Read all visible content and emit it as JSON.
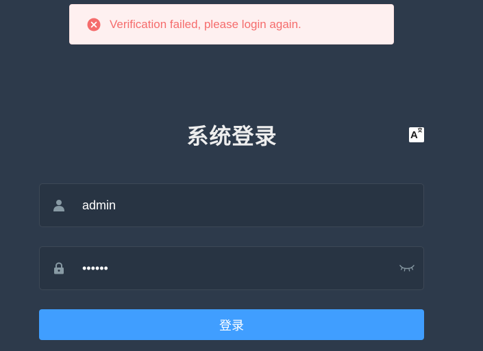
{
  "message": {
    "type": "error",
    "icon": "circle-close-icon",
    "text": "Verification failed, please login again.",
    "color": "#f56c6c",
    "background": "#fef0f0"
  },
  "login": {
    "title": "系统登录",
    "language_icon": "translate-icon",
    "username": {
      "icon": "user-icon",
      "value": "admin",
      "placeholder": ""
    },
    "password": {
      "icon": "lock-icon",
      "value": "••••••",
      "placeholder": "",
      "toggle_icon": "eye-closed-icon"
    },
    "submit_label": "登录"
  },
  "colors": {
    "page_background": "#2d3a4b",
    "input_background": "#283443",
    "primary": "#409eff",
    "title": "#eeeeee"
  }
}
